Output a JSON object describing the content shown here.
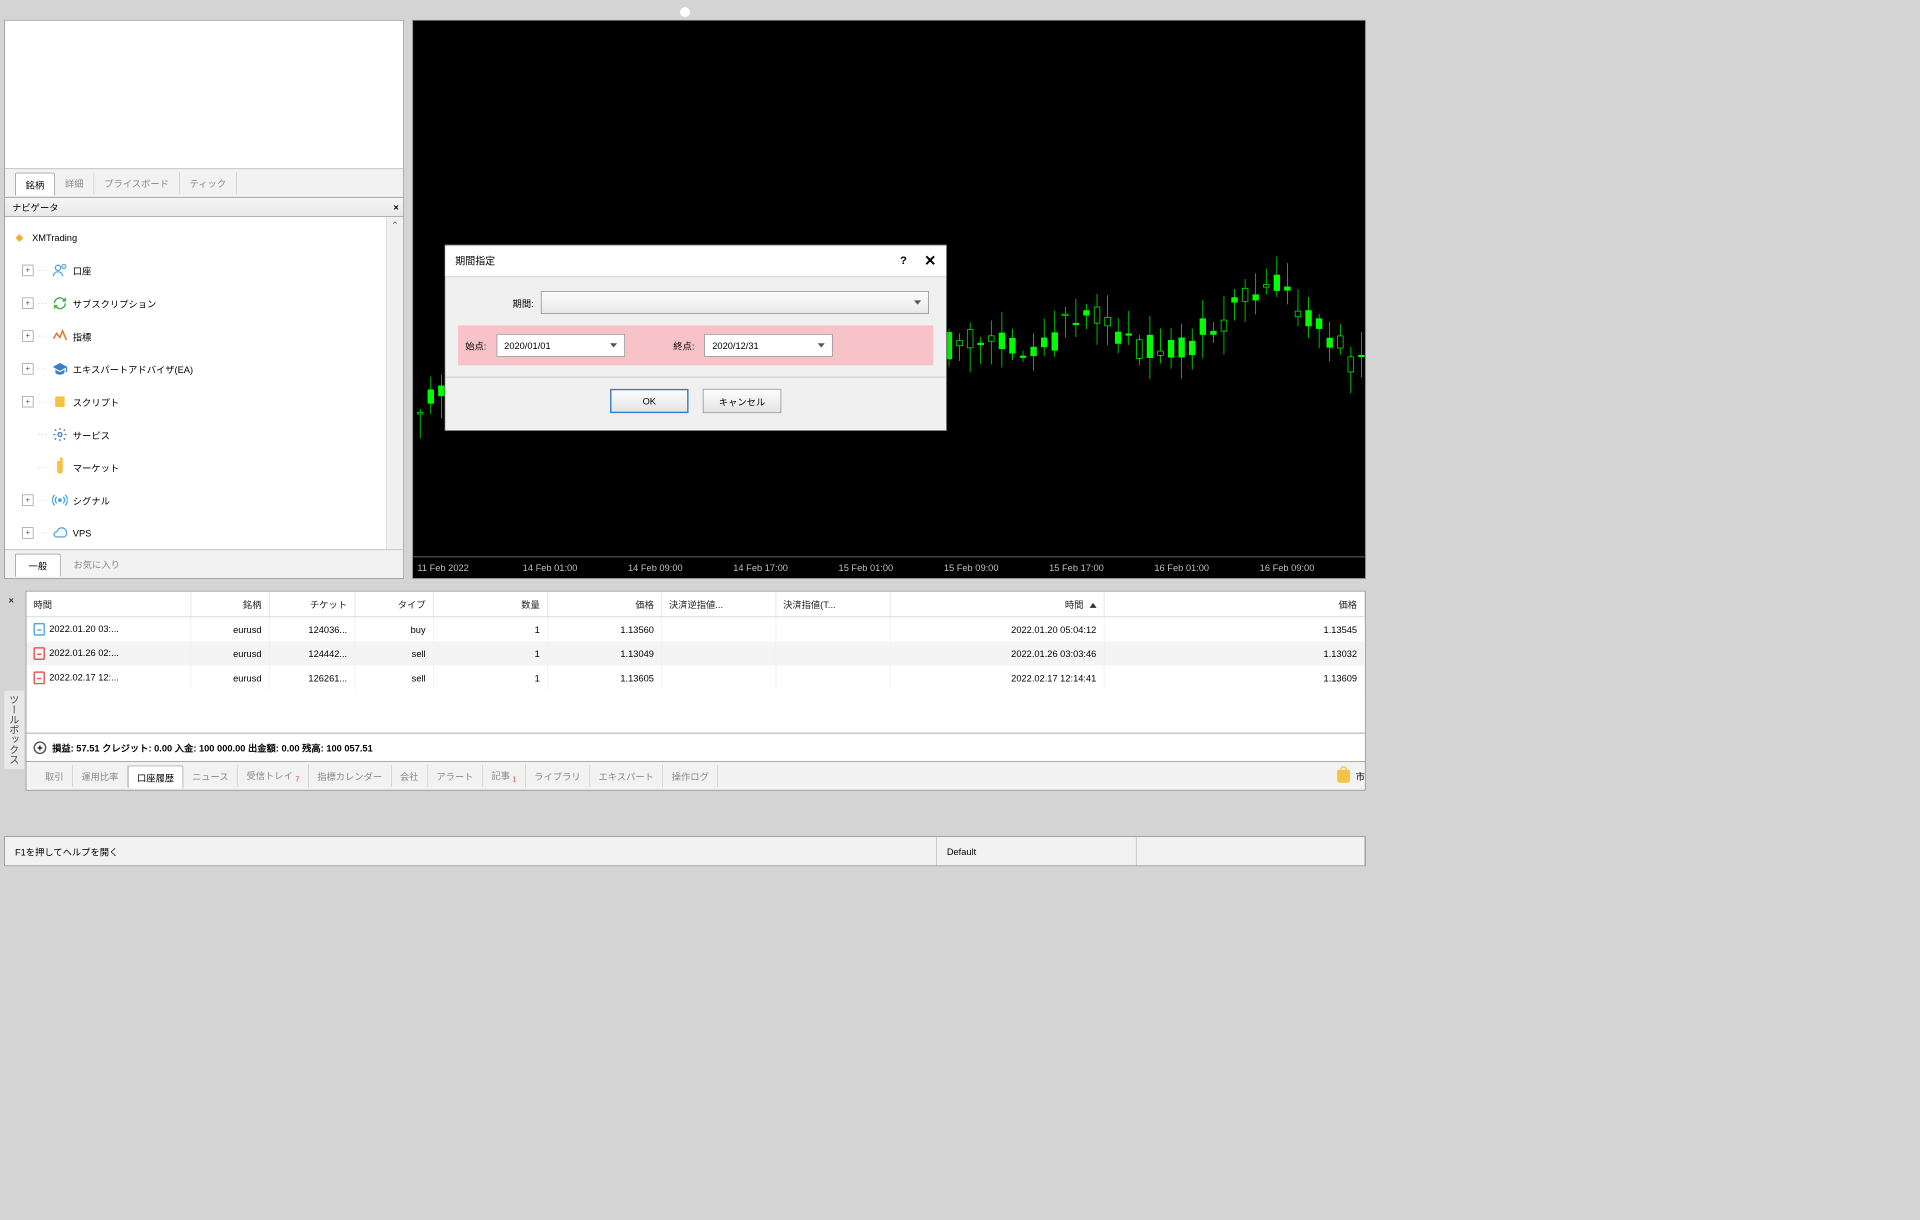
{
  "market_watch_tabs": {
    "symbols": "銘柄",
    "details": "詳細",
    "priceboard": "プライスボード",
    "tick": "ティック"
  },
  "navigator": {
    "title": "ナビゲータ",
    "root": "XMTrading",
    "items": [
      {
        "label": "口座"
      },
      {
        "label": "サブスクリプション"
      },
      {
        "label": "指標"
      },
      {
        "label": "エキスパートアドバイザ(EA)"
      },
      {
        "label": "スクリプト"
      },
      {
        "label": "サービス"
      },
      {
        "label": "マーケット"
      },
      {
        "label": "シグナル"
      },
      {
        "label": "VPS"
      }
    ],
    "bottom_tabs": {
      "general": "一般",
      "favorites": "お気に入り"
    }
  },
  "dialog": {
    "title": "期間指定",
    "period_label": "期間:",
    "start_label": "始点:",
    "start_value": "2020/01/01",
    "end_label": "終点:",
    "end_value": "2020/12/31",
    "ok": "OK",
    "cancel": "キャンセル"
  },
  "chart": {
    "timeline": [
      "11 Feb 2022",
      "14 Feb 01:00",
      "14 Feb 09:00",
      "14 Feb 17:00",
      "15 Feb 01:00",
      "15 Feb 09:00",
      "15 Feb 17:00",
      "16 Feb 01:00",
      "16 Feb 09:00"
    ]
  },
  "table": {
    "headers": {
      "time": "時間",
      "symbol": "銘柄",
      "ticket": "チケット",
      "type": "タイプ",
      "volume": "数量",
      "price": "価格",
      "sl": "決済逆指値...",
      "tp": "決済指値(T...",
      "time2": "時間",
      "price2": "価格"
    },
    "rows": [
      {
        "time": "2022.01.20 03:...",
        "symbol": "eurusd",
        "ticket": "124036...",
        "type": "buy",
        "volume": "1",
        "price": "1.13560",
        "sl": "",
        "tp": "",
        "time2": "2022.01.20 05:04:12",
        "price2": "1.13545",
        "red": false
      },
      {
        "time": "2022.01.26 02:...",
        "symbol": "eurusd",
        "ticket": "124442...",
        "type": "sell",
        "volume": "1",
        "price": "1.13049",
        "sl": "",
        "tp": "",
        "time2": "2022.01.26 03:03:46",
        "price2": "1.13032",
        "red": true
      },
      {
        "time": "2022.02.17 12:...",
        "symbol": "eurusd",
        "ticket": "126261...",
        "type": "sell",
        "volume": "1",
        "price": "1.13605",
        "sl": "",
        "tp": "",
        "time2": "2022.02.17 12:14:41",
        "price2": "1.13609",
        "red": true
      }
    ]
  },
  "summary": "損益: 57.51  クレジット: 0.00  入金: 100 000.00  出金額: 0.00  残高: 100 057.51",
  "toolbox": {
    "label": "ツールボックス",
    "tabs": [
      "取引",
      "運用比率",
      "口座履歴",
      "ニュース",
      "受信トレイ",
      "指標カレンダー",
      "会社",
      "アラート",
      "記事",
      "ライブラリ",
      "エキスパート",
      "操作ログ"
    ],
    "active_index": 2,
    "inbox_badge": "7",
    "articles_badge": "1",
    "market_tail": "市"
  },
  "statusbar": {
    "help": "F1を押してヘルプを開く",
    "profile": "Default"
  }
}
